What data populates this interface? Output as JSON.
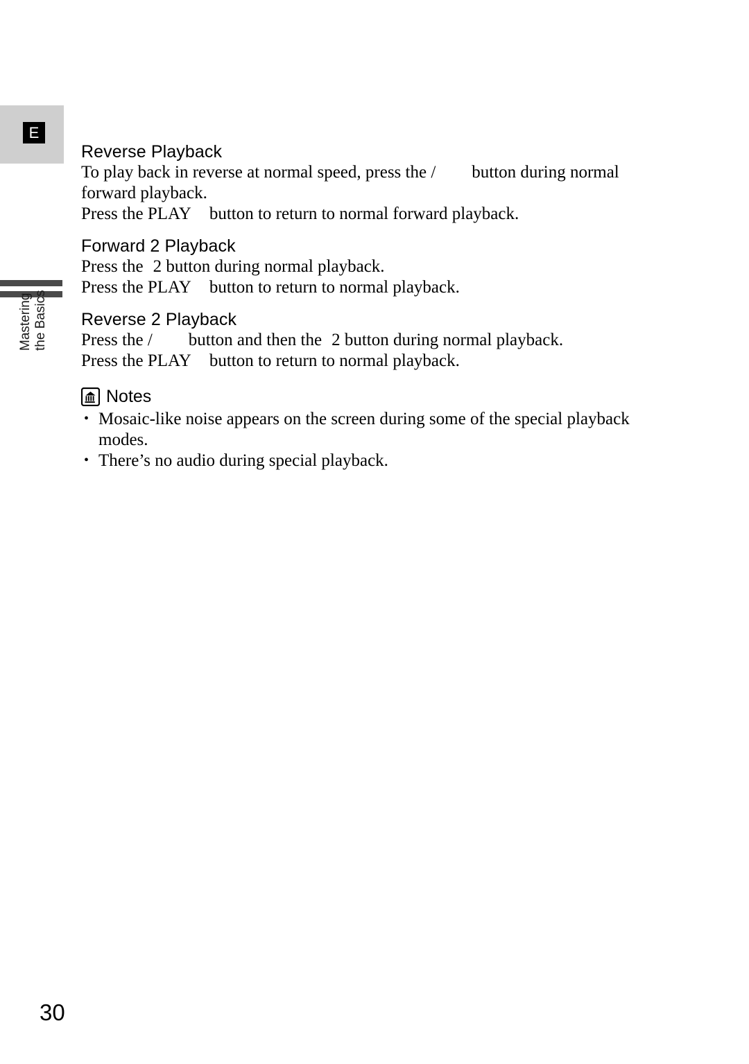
{
  "page": {
    "number": "30",
    "language_badge": "E",
    "side_tab": {
      "line1": "Mastering",
      "line2": "the Basics"
    }
  },
  "sections": [
    {
      "heading": "Reverse Playback",
      "lines": [
        {
          "parts": [
            {
              "type": "text",
              "value": "To play back in reverse at normal speed, press the /"
            },
            {
              "type": "gap",
              "value": ""
            },
            {
              "type": "text",
              "value": "button during normal"
            }
          ]
        },
        {
          "parts": [
            {
              "type": "text",
              "value": "forward playback."
            }
          ]
        },
        {
          "parts": [
            {
              "type": "text",
              "value": "Press the PLAY"
            },
            {
              "type": "gap",
              "value": ""
            },
            {
              "type": "text",
              "value": "button to return to normal forward playback."
            }
          ]
        }
      ]
    },
    {
      "heading": "Forward  2 Playback",
      "lines": [
        {
          "parts": [
            {
              "type": "text",
              "value": "Press the"
            },
            {
              "type": "gap",
              "value": ""
            },
            {
              "type": "text",
              "value": "2 button during normal playback."
            }
          ]
        },
        {
          "parts": [
            {
              "type": "text",
              "value": "Press the PLAY"
            },
            {
              "type": "gap",
              "value": ""
            },
            {
              "type": "text",
              "value": "button to return to normal playback."
            }
          ]
        }
      ]
    },
    {
      "heading": "Reverse 2 Playback",
      "lines": [
        {
          "parts": [
            {
              "type": "text",
              "value": "Press the /"
            },
            {
              "type": "gap",
              "value": ""
            },
            {
              "type": "text",
              "value": "button and then the"
            },
            {
              "type": "gap",
              "value": ""
            },
            {
              "type": "text",
              "value": "2 button during normal playback."
            }
          ]
        },
        {
          "parts": [
            {
              "type": "text",
              "value": "Press the PLAY"
            },
            {
              "type": "gap",
              "value": ""
            },
            {
              "type": "text",
              "value": "button to return to normal playback."
            }
          ]
        }
      ]
    }
  ],
  "notes": {
    "icon": "notes-bank-icon",
    "title": "Notes",
    "items": [
      "Mosaic-like noise appears on the screen during some of the special playback modes.",
      "There’s no audio during special playback."
    ]
  },
  "sect_heads": {
    "reverse_playback": "Reverse Playback",
    "forward_2x": "Forward  2 Playback",
    "reverse_2x": "Reverse 2 Playback"
  },
  "lines": {
    "rev_l1a": "To play back in reverse at normal speed, press the /",
    "rev_l1b": "button during normal",
    "rev_l2": "forward playback.",
    "rev_l3a": "Press the PLAY",
    "rev_l3b": "button to return to normal forward playback.",
    "f2_l1a": "Press the",
    "f2_l1b": "2 button during normal playback.",
    "f2_l2a": "Press the PLAY",
    "f2_l2b": "button to return to normal playback.",
    "r2_l1a": "Press the /",
    "r2_l1b": "button and then the",
    "r2_l1c": "2 button during normal playback.",
    "r2_l2a": "Press the PLAY",
    "r2_l2b": "button to return to normal playback."
  },
  "notes_text": {
    "title": "Notes",
    "item1_line1": "Mosaic-like noise appears on the screen during some of the special playback",
    "item1_line2": "modes.",
    "item2": "There’s no audio during special playback."
  },
  "colors": {
    "badge_panel": "#cfcfcf",
    "badge_square": "#000000",
    "badge_letter": "#ffffff",
    "tab_bar": "#4a4a4a",
    "text": "#000000",
    "page_background": "#ffffff"
  }
}
